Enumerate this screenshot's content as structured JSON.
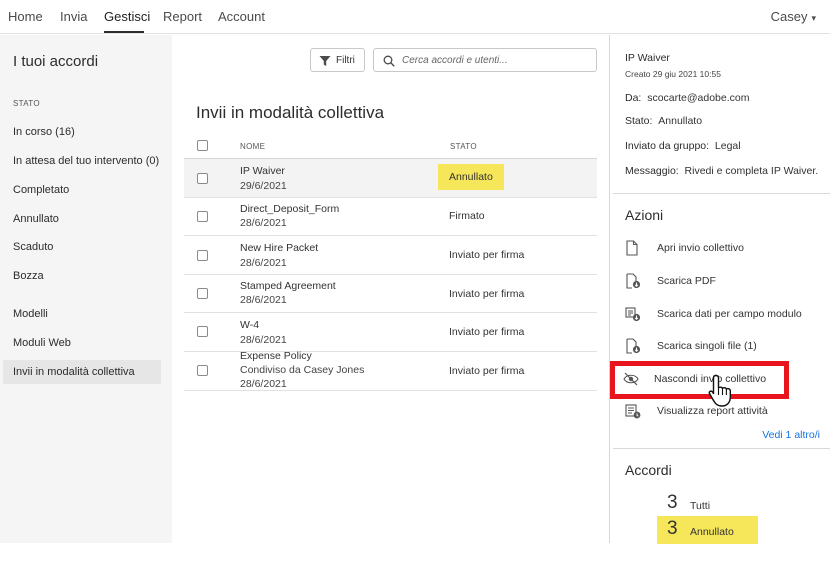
{
  "nav": {
    "tabs": [
      {
        "label": "Home"
      },
      {
        "label": "Invia"
      },
      {
        "label": "Gestisci",
        "active": true
      },
      {
        "label": "Report"
      },
      {
        "label": "Account"
      }
    ],
    "user": "Casey"
  },
  "toolbar": {
    "page_title": "I tuoi accordi",
    "filter_label": "Filtri",
    "search_placeholder": "Cerca accordi e utenti..."
  },
  "sidebar": {
    "section_label": "STATO",
    "status_items": [
      {
        "label": "In corso (16)"
      },
      {
        "label": "In attesa del tuo intervento (0)"
      },
      {
        "label": "Completato"
      },
      {
        "label": "Annullato"
      },
      {
        "label": "Scaduto"
      },
      {
        "label": "Bozza"
      }
    ],
    "other_items": [
      {
        "label": "Modelli"
      },
      {
        "label": "Moduli Web"
      },
      {
        "label": "Invii in modalità collettiva",
        "selected": true
      }
    ]
  },
  "list": {
    "title": "Invii in modalità collettiva",
    "columns": {
      "name": "NOME",
      "status": "STATO"
    },
    "rows": [
      {
        "name": "IP Waiver",
        "sub": "29/6/2021",
        "status": "Annullato",
        "selected": true,
        "highlight": true
      },
      {
        "name": "Direct_Deposit_Form",
        "sub": "28/6/2021",
        "status": "Firmato"
      },
      {
        "name": "New Hire Packet",
        "sub": "28/6/2021",
        "status": "Inviato per firma"
      },
      {
        "name": "Stamped Agreement",
        "sub": "28/6/2021",
        "status": "Inviato per firma"
      },
      {
        "name": "W-4",
        "sub": "28/6/2021",
        "status": "Inviato per firma"
      },
      {
        "name": "Expense Policy",
        "sub2": "Condiviso da Casey Jones",
        "sub": "28/6/2021",
        "status": "Inviato per firma"
      }
    ]
  },
  "details": {
    "title": "IP Waiver",
    "created": "Creato 29 giu 2021 10:55",
    "fields": [
      {
        "key": "Da:",
        "value": "scocarte@adobe.com"
      },
      {
        "key": "Stato:",
        "value": "Annullato"
      },
      {
        "key": "Inviato da gruppo:",
        "value": "Legal"
      },
      {
        "key": "Messaggio:",
        "value": "Rivedi e completa IP Waiver."
      }
    ]
  },
  "actions": {
    "heading": "Azioni",
    "items": [
      {
        "label": "Apri invio collettivo",
        "icon": "document-icon"
      },
      {
        "label": "Scarica PDF",
        "icon": "download-pdf-icon"
      },
      {
        "label": "Scarica dati per campo modulo",
        "icon": "download-csv-icon"
      },
      {
        "label": "Scarica singoli file (1)",
        "icon": "download-file-icon"
      },
      {
        "label": "Nascondi invio collettivo",
        "icon": "eye-hide-icon",
        "highlighted": true
      },
      {
        "label": "Visualizza report attività",
        "icon": "report-icon"
      }
    ],
    "see_more": "Vedi 1 altro/i"
  },
  "agreements": {
    "heading": "Accordi",
    "counts": [
      {
        "num": "3",
        "label": "Tutti"
      },
      {
        "num": "3",
        "label": "Annullato",
        "highlight": true
      }
    ]
  },
  "colors": {
    "highlight_yellow": "#f5e65a",
    "callout_red": "#e8141e",
    "link_blue": "#1473e6"
  }
}
